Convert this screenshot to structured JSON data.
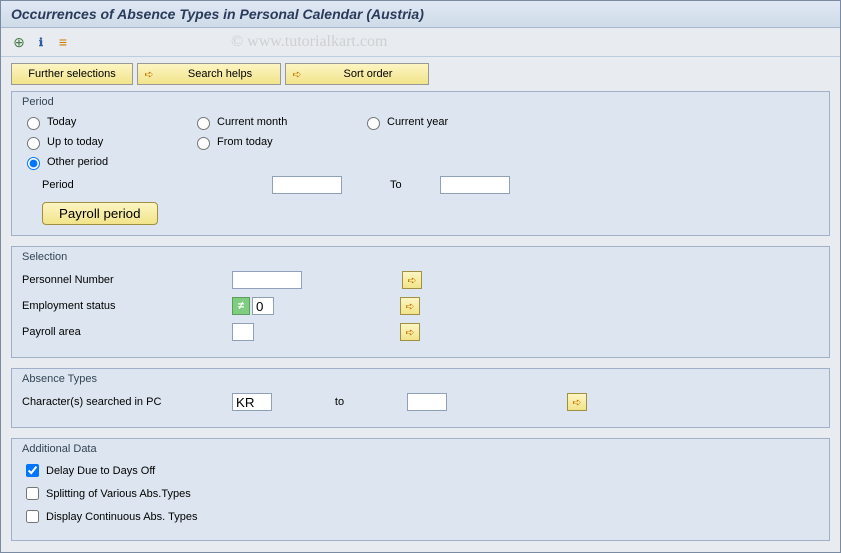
{
  "title": "Occurrences of Absence Types in Personal Calendar (Austria)",
  "watermark": "© www.tutorialkart.com",
  "buttons": {
    "further_selections": "Further selections",
    "search_helps": "Search helps",
    "sort_order": "Sort order"
  },
  "period": {
    "group_title": "Period",
    "today": "Today",
    "current_month": "Current month",
    "current_year": "Current year",
    "up_to_today": "Up to today",
    "from_today": "From today",
    "other_period": "Other period",
    "period_label": "Period",
    "to_label": "To",
    "period_from": "",
    "period_to": "",
    "payroll_period_btn": "Payroll period",
    "selected": "Other period"
  },
  "selection": {
    "group_title": "Selection",
    "pernr_label": "Personnel Number",
    "pernr_value": "",
    "empstat_label": "Employment status",
    "empstat_value": "0",
    "payarea_label": "Payroll area",
    "payarea_value": ""
  },
  "abstypes": {
    "group_title": "Absence Types",
    "char_label": "Character(s) searched in PC",
    "char_value": "KR",
    "to_label": "to",
    "to_value": ""
  },
  "additional": {
    "group_title": "Additional Data",
    "delay_label": "Delay Due to Days Off",
    "delay_checked": true,
    "split_label": "Splitting of Various Abs.Types",
    "split_checked": false,
    "cont_label": "Display Continuous Abs. Types",
    "cont_checked": false
  }
}
